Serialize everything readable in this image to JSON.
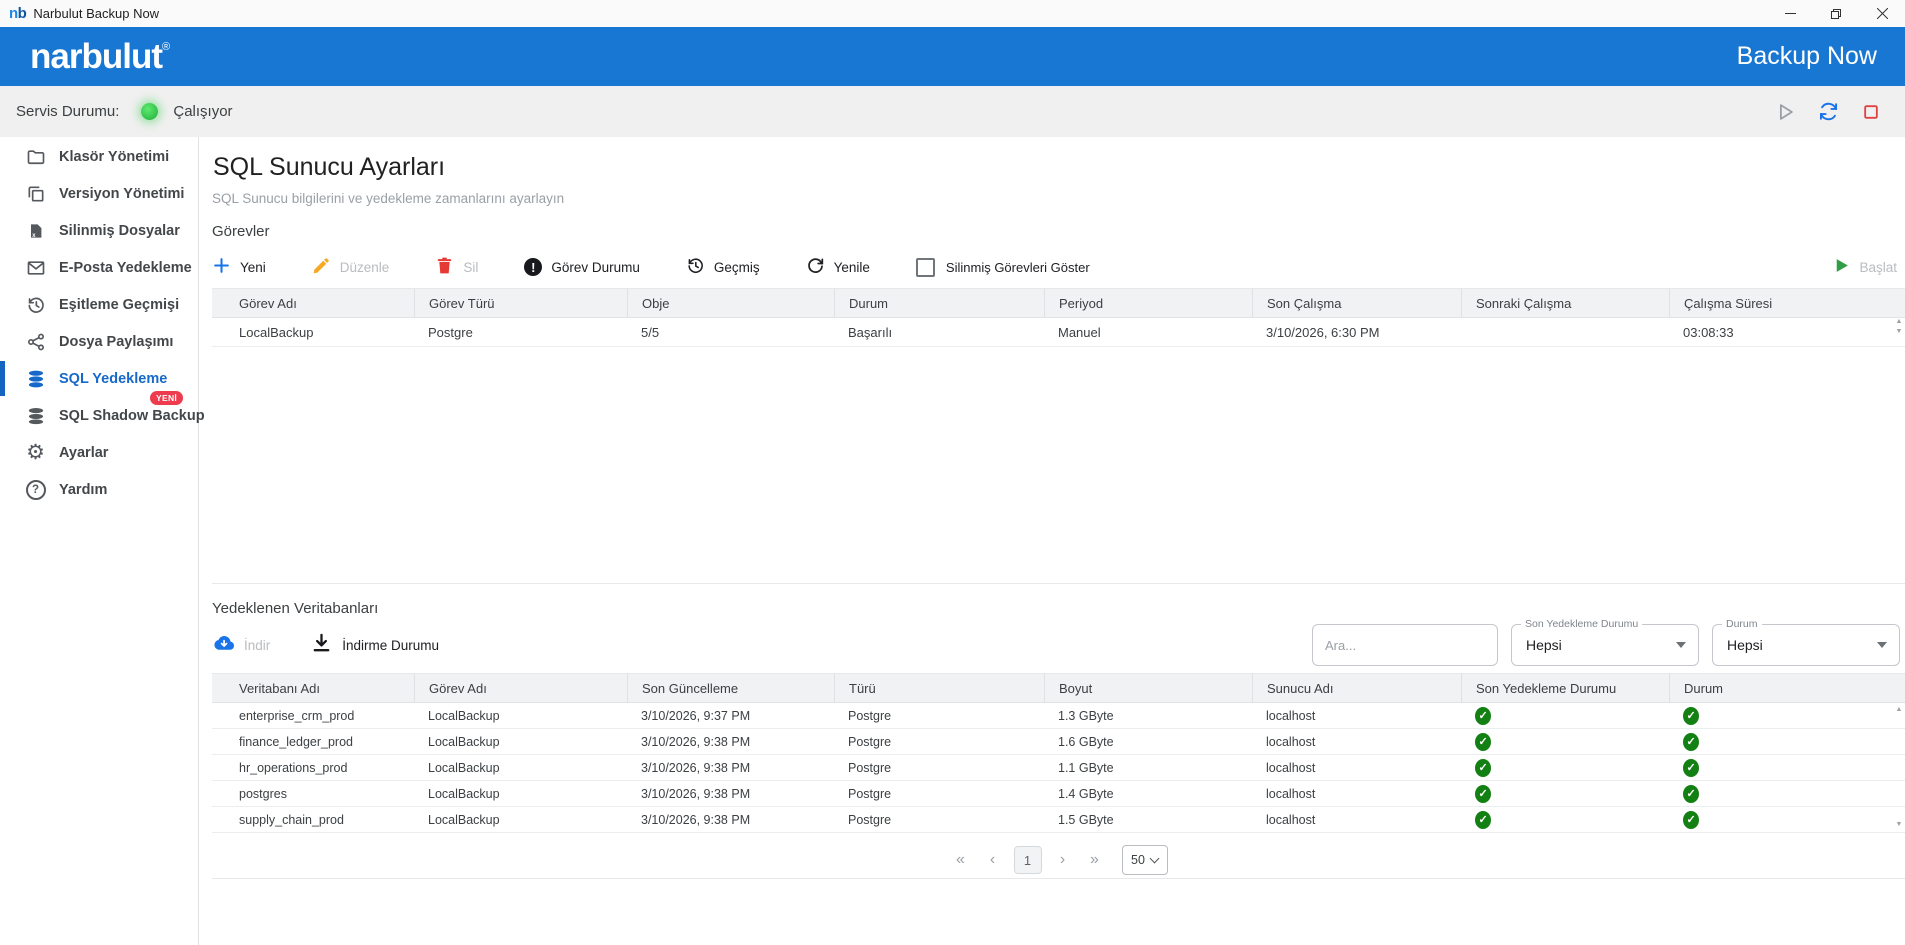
{
  "window": {
    "logo_n": "n",
    "logo_b": "b",
    "title": "Narbulut Backup Now"
  },
  "header": {
    "brand": "narbulut",
    "registered": "®",
    "right_title": "Backup Now"
  },
  "status_bar": {
    "label": "Servis Durumu:",
    "value": "Çalışıyor"
  },
  "sidebar": {
    "items": [
      {
        "label": "Klasör Yönetimi",
        "icon": "folder"
      },
      {
        "label": "Versiyon Yönetimi",
        "icon": "versions"
      },
      {
        "label": "Silinmiş Dosyalar",
        "icon": "deleted-file"
      },
      {
        "label": "E-Posta Yedekleme",
        "icon": "mail"
      },
      {
        "label": "Eşitleme Geçmişi",
        "icon": "history"
      },
      {
        "label": "Dosya Paylaşımı",
        "icon": "share"
      },
      {
        "label": "SQL Yedekleme",
        "icon": "database",
        "selected": true
      },
      {
        "label": "SQL Shadow Backup",
        "icon": "database-shadow",
        "badge": "YENİ"
      },
      {
        "label": "Ayarlar",
        "icon": "gear"
      },
      {
        "label": "Yardım",
        "icon": "help"
      }
    ]
  },
  "main": {
    "title": "SQL Sunucu Ayarları",
    "subtitle": "SQL Sunucu bilgilerini ve yedekleme zamanlarını ayarlayın",
    "tasks": {
      "heading": "Görevler",
      "toolbar": {
        "yeni": "Yeni",
        "duzenle": "Düzenle",
        "sil": "Sil",
        "gorev_durumu": "Görev Durumu",
        "gecmis": "Geçmiş",
        "yenile": "Yenile",
        "show_deleted": "Silinmiş Görevleri Göster",
        "baslat": "Başlat"
      },
      "columns": [
        "Görev Adı",
        "Görev Türü",
        "Obje",
        "Durum",
        "Periyod",
        "Son Çalışma",
        "Sonraki Çalışma",
        "Çalışma Süresi"
      ],
      "rows": [
        [
          "LocalBackup",
          "Postgre",
          "5/5",
          "Başarılı",
          "Manuel",
          "3/10/2026, 6:30 PM",
          "",
          "03:08:33"
        ]
      ]
    },
    "databases": {
      "heading": "Yedeklenen Veritabanları",
      "toolbar": {
        "indir": "İndir",
        "indirme_durumu": "İndirme Durumu"
      },
      "search_placeholder": "Ara...",
      "filters": [
        {
          "label": "Son Yedekleme Durumu",
          "value": "Hepsi"
        },
        {
          "label": "Durum",
          "value": "Hepsi"
        }
      ],
      "columns": [
        "Veritabanı Adı",
        "Görev Adı",
        "Son Güncelleme",
        "Türü",
        "Boyut",
        "Sunucu Adı",
        "Son Yedekleme Durumu",
        "Durum"
      ],
      "rows": [
        [
          "enterprise_crm_prod",
          "LocalBackup",
          "3/10/2026, 9:37 PM",
          "Postgre",
          "1.3 GByte",
          "localhost"
        ],
        [
          "finance_ledger_prod",
          "LocalBackup",
          "3/10/2026, 9:38 PM",
          "Postgre",
          "1.6 GByte",
          "localhost"
        ],
        [
          "hr_operations_prod",
          "LocalBackup",
          "3/10/2026, 9:38 PM",
          "Postgre",
          "1.1 GByte",
          "localhost"
        ],
        [
          "postgres",
          "LocalBackup",
          "3/10/2026, 9:38 PM",
          "Postgre",
          "1.4 GByte",
          "localhost"
        ],
        [
          "supply_chain_prod",
          "LocalBackup",
          "3/10/2026, 9:38 PM",
          "Postgre",
          "1.5 GByte",
          "localhost"
        ]
      ],
      "pagination": {
        "first": "«",
        "prev": "‹",
        "page": "1",
        "next": "›",
        "last": "»",
        "page_size": "50"
      }
    }
  },
  "colors": {
    "accent_blue": "#1877d2",
    "selected_blue": "#1669c9",
    "success_green": "#138013",
    "running_dot_green": "#2ecc40",
    "badge_red": "#ee3b4d",
    "danger_red": "#e53935",
    "pencil_orange": "#f6a821"
  }
}
